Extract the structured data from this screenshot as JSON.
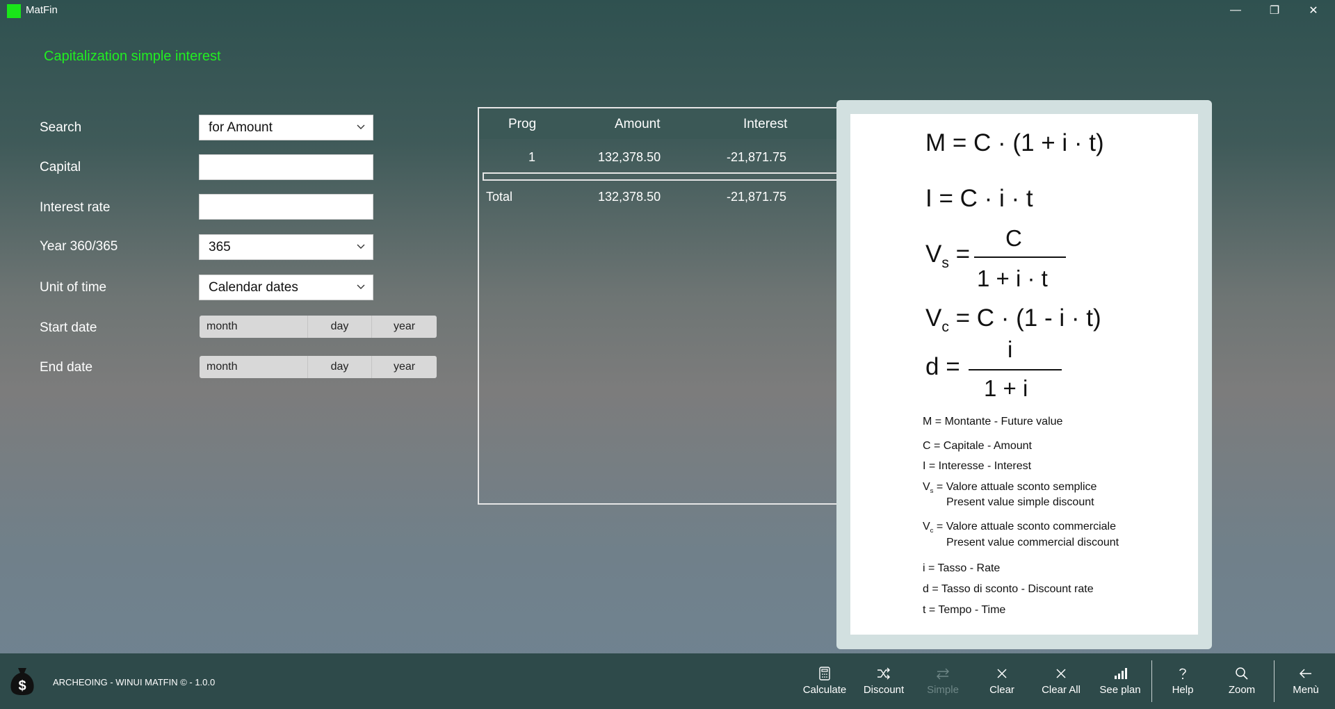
{
  "window": {
    "title": "MatFin",
    "controls": {
      "minimize": "—",
      "maximize": "❐",
      "close": "✕"
    }
  },
  "page": {
    "title": "Capitalization simple interest"
  },
  "form": {
    "search": {
      "label": "Search",
      "value": "for Amount"
    },
    "capital": {
      "label": "Capital",
      "value": ""
    },
    "interest_rate": {
      "label": "Interest rate",
      "value": ""
    },
    "year_basis": {
      "label": "Year 360/365",
      "value": "365"
    },
    "unit_of_time": {
      "label": "Unit of time",
      "value": "Calendar dates"
    },
    "start_date": {
      "label": "Start date",
      "month": "month",
      "day": "day",
      "year": "year"
    },
    "end_date": {
      "label": "End date",
      "month": "month",
      "day": "day",
      "year": "year"
    }
  },
  "table": {
    "headers": [
      "Prog",
      "Amount",
      "Interest"
    ],
    "rows": [
      {
        "prog": "1",
        "amount": "132,378.50",
        "interest": "-21,871.75"
      }
    ],
    "total": {
      "label": "Total",
      "amount": "132,378.50",
      "interest": "-21,871.75"
    }
  },
  "formulas": {
    "f1": "M = C · (1 + i · t)",
    "f2": "I = C · i · t",
    "f3_left": "V",
    "f3_sub": "s",
    "f3_eq": "=",
    "f3_num": "C",
    "f3_den": "1 + i · t",
    "f4_left": "V",
    "f4_sub": "c",
    "f4_rest": "= C · (1 - i · t)",
    "f5_left": "d =",
    "f5_num": "i",
    "f5_den": "1 + i",
    "legend": [
      "M = Montante  -  Future value",
      "C =  Capitale  -  Amount",
      "I = Interesse - Interest",
      "= Valore attuale sconto semplice",
      "Present value simple discount",
      "= Valore attuale sconto commerciale",
      "Present value commercial discount",
      "i = Tasso     -  Rate",
      "d = Tasso di sconto  -  Discount rate",
      "t = Tempo  -  Time"
    ],
    "legend_v": "V",
    "legend_vs_sub": "s",
    "legend_vc_sub": "c"
  },
  "footer": {
    "text": "ARCHEOING - WINUI MATFIN © - 1.0.0"
  },
  "commands": [
    {
      "label": "Calculate",
      "icon": "calculator-icon",
      "enabled": true
    },
    {
      "label": "Discount",
      "icon": "shuffle-icon",
      "enabled": true
    },
    {
      "label": "Simple",
      "icon": "swap-icon",
      "enabled": false
    },
    {
      "label": "Clear",
      "icon": "close-icon",
      "enabled": true
    },
    {
      "label": "Clear All",
      "icon": "close-icon",
      "enabled": true
    },
    {
      "label": "See plan",
      "icon": "bar-chart-icon",
      "enabled": true
    },
    {
      "label": "Help",
      "icon": "help-icon",
      "enabled": true
    },
    {
      "label": "Zoom",
      "icon": "search-icon",
      "enabled": true
    },
    {
      "label": "Menù",
      "icon": "back-arrow-icon",
      "enabled": true
    }
  ],
  "colors": {
    "accent": "#22ee22",
    "logo": "#19e619",
    "commandbar": "#2e4a4a",
    "table_header": "#3b5856"
  }
}
